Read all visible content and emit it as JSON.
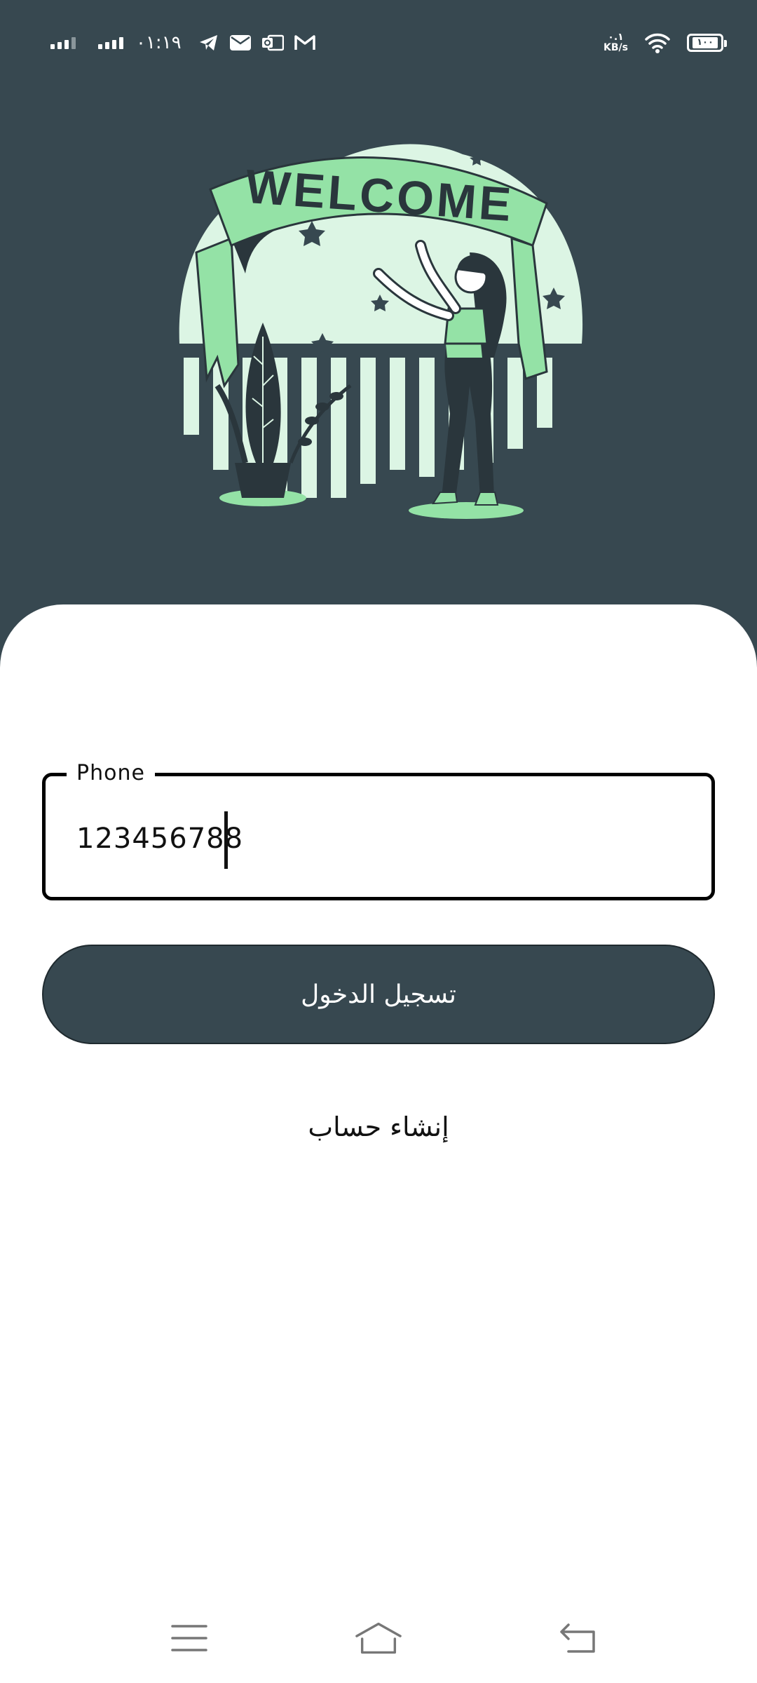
{
  "status_bar": {
    "time": "٠١:١٩",
    "network_speed_value": "٠.١",
    "network_speed_unit": "KB/s",
    "battery": "١٠٠",
    "notification_icons": [
      "telegram-icon",
      "mail-icon",
      "outlook-icon",
      "gmail-icon"
    ]
  },
  "hero": {
    "banner_text": "WELCOME"
  },
  "form": {
    "phone_label": "Phone",
    "phone_value": "123456788",
    "login_button": "تسجيل الدخول",
    "create_account_link": "إنشاء حساب"
  },
  "colors": {
    "primary": "#374850",
    "accent_green": "#94e2a6",
    "light_green": "#dcf5e4",
    "background": "#ffffff"
  },
  "nav_bar": {
    "buttons": [
      "menu-icon",
      "home-icon",
      "back-icon"
    ]
  }
}
